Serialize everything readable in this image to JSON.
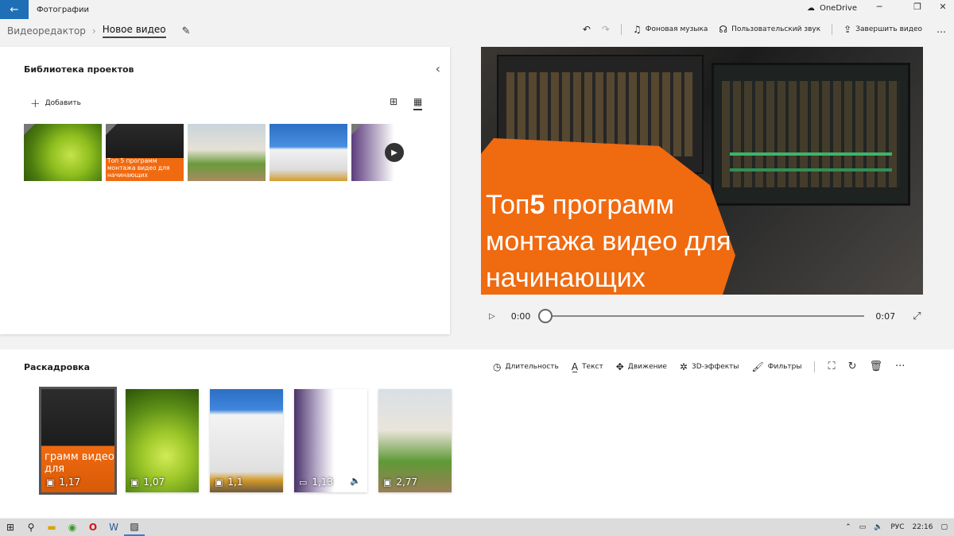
{
  "app": {
    "title": "Фотографии",
    "onedrive": "OneDrive"
  },
  "breadcrumb": {
    "root": "Видеоредактор",
    "current": "Новое видео"
  },
  "commands": {
    "bg_music": "Фоновая музыка",
    "custom_audio": "Пользовательский звук",
    "finish": "Завершить видео"
  },
  "library": {
    "title": "Библиотека проектов",
    "add": "Добавить",
    "thumb_text": "Топ 5 программ монтажа видео для начинающих"
  },
  "preview": {
    "line1_a": "Топ",
    "line1_b": "5",
    "line1_c": "программ",
    "line2": "монтажа видео для",
    "line3": "начинающих"
  },
  "player": {
    "time_start": "0:00",
    "time_end": "0:07",
    "progress": 0
  },
  "storyboard": {
    "title": "Раскадровка",
    "tools": {
      "duration": "Длительность",
      "text": "Текст",
      "motion": "Движение",
      "effects3d": "3D-эффекты",
      "filters": "Фильтры"
    },
    "clip_text": "грамм видео для",
    "clips": [
      {
        "duration": "1,17"
      },
      {
        "duration": "1,07"
      },
      {
        "duration": "1,1"
      },
      {
        "duration": "1,13"
      },
      {
        "duration": "2,77"
      }
    ]
  },
  "tray": {
    "lang": "РУС",
    "time": "22:16"
  }
}
